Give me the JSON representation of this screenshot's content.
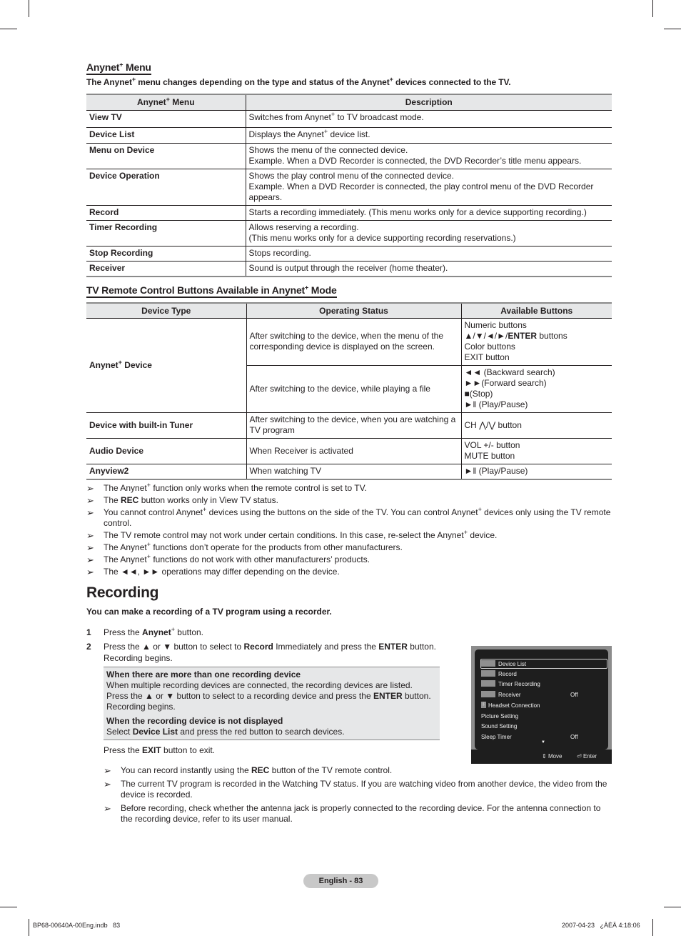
{
  "anynet_menu": {
    "heading": "Anynet",
    "heading_suffix": "Menu",
    "subheading_part1": "The Anynet",
    "subheading_part2": "menu changes depending on the type and status of the Anynet",
    "subheading_part3": "devices connected to the TV.",
    "table": {
      "headers": {
        "menu_part1": "Anynet",
        "menu_part2": "Menu",
        "description": "Description"
      },
      "rows": [
        {
          "menu": "View TV",
          "desc_lines": [
            "Switches from Anynet",
            "to TV broadcast mode."
          ]
        },
        {
          "menu": "Device List",
          "desc_lines": [
            "Displays the Anynet",
            "device list."
          ]
        },
        {
          "menu": "Menu on Device",
          "desc_lines": [
            "Shows the menu of the connected device.",
            "Example. When a DVD Recorder is connected, the DVD Recorder’s title menu appears."
          ]
        },
        {
          "menu": "Device Operation",
          "desc_lines": [
            "Shows the play control menu of the connected device.",
            "Example. When a DVD Recorder is connected, the play control menu of the DVD Recorder appears."
          ]
        },
        {
          "menu": "Record",
          "desc_lines": [
            "Starts a recording immediately. (This menu works only for a device supporting recording.)"
          ]
        },
        {
          "menu": "Timer Recording",
          "desc_lines": [
            "Allows reserving a recording.",
            "(This menu works only for a device supporting recording reservations.)"
          ]
        },
        {
          "menu": "Stop Recording",
          "desc_lines": [
            "Stops recording."
          ]
        },
        {
          "menu": "Receiver",
          "desc_lines": [
            "Sound is output through the receiver (home theater)."
          ]
        }
      ]
    }
  },
  "remote_buttons": {
    "heading_part1": "TV Remote Control Buttons Available in Anynet",
    "heading_part2": "Mode",
    "table": {
      "headers": [
        "Device Type",
        "Operating Status",
        "Available Buttons"
      ],
      "anynet_device": {
        "type_part1": "Anynet",
        "type_part2": "Device",
        "row1": {
          "status": "After switching to the device, when the menu of the corresponding device is displayed on the screen.",
          "buttons": [
            "Numeric buttons",
            "▲/▼/◄/►/",
            "ENTER",
            "buttons",
            "Color buttons",
            "EXIT button"
          ]
        },
        "row2": {
          "status": "After switching to the device, while playing a file",
          "buttons": [
            "◄◄ (Backward search)",
            "►►(Forward search)",
            "■(Stop)",
            "►ǁ (Play/Pause)"
          ]
        }
      },
      "rows": [
        {
          "type": "Device with built-in Tuner",
          "status": "After switching to the device, when you are watching a TV program",
          "buttons": [
            "CH ⋀/⋁ button"
          ]
        },
        {
          "type": "Audio Device",
          "status": "When Receiver is activated",
          "buttons": [
            "VOL +/- button",
            "MUTE button"
          ]
        },
        {
          "type": "Anyview2",
          "status": "When watching TV",
          "buttons": [
            "►ǁ (Play/Pause)"
          ]
        }
      ]
    },
    "notes": [
      {
        "parts": [
          "The Anynet",
          "function only works when the remote control is set to TV."
        ]
      },
      {
        "pre": "The ",
        "bold": "REC",
        "post": " button works only in View TV status."
      },
      {
        "parts": [
          "You cannot control Anynet",
          "devices using the buttons on the side of the TV. You can control Anynet",
          "devices only using the TV remote control."
        ]
      },
      {
        "parts": [
          "The TV remote control may not work under certain conditions. In this case, re-select the Anynet",
          "device."
        ]
      },
      {
        "parts": [
          "The Anynet",
          "functions don’t operate for the products from other manufacturers."
        ]
      },
      {
        "parts": [
          "The Anynet",
          "functions do not work with other manufacturers’ products."
        ]
      },
      {
        "text": "The ◄◄, ►► operations may differ depending on the device."
      }
    ]
  },
  "recording": {
    "title": "Recording",
    "lead": "You can make a recording of a TV program using a recorder.",
    "steps": [
      {
        "num": "1",
        "pre": "Press the ",
        "bold": "Anynet",
        "post": " button."
      },
      {
        "num": "2",
        "pre": "Press the ▲ or ▼ button to select to ",
        "bold": "Record",
        "mid": " Immediately and press the ",
        "bold2": "ENTER",
        "post": " button. Recording begins."
      }
    ],
    "infobox": {
      "title1": "When there are more than one recording device",
      "line1": "When multiple recording devices are connected, the recording devices are listed.",
      "line2_pre": "Press the ▲ or ▼ button to select to a recording device and press the ",
      "line2_bold": "ENTER",
      "line2_post": " button. Recording begins.",
      "title2": "When the recording device is not displayed",
      "line3_pre": "Select ",
      "line3_bold": "Device List",
      "line3_post": " and press the red button to search devices."
    },
    "exit_pre": "Press the ",
    "exit_bold": "EXIT",
    "exit_post": " button to exit.",
    "notes": [
      {
        "pre": "You can record instantly using the ",
        "bold": "REC",
        "post": " button of the TV remote control."
      },
      {
        "text": "The current TV program is recorded in the Watching TV status. If you are watching video from another device, the video from the device is recorded."
      },
      {
        "text": "Before recording, check whether the antenna jack is properly connected to the recording device. For the antenna connection to the recording device, refer to its user manual."
      }
    ],
    "osd": {
      "items": [
        {
          "label": "Device List",
          "icon": "anynet-logo",
          "value": "",
          "selected": true
        },
        {
          "label": "Record",
          "icon": "anynet-logo",
          "value": ""
        },
        {
          "label": "Timer Recording",
          "icon": "anynet-logo",
          "value": ""
        },
        {
          "label": "Receiver",
          "icon": "anynet-logo",
          "value": "Off"
        },
        {
          "label": "Headset Connection",
          "icon": "bluetooth-icon",
          "value": ""
        },
        {
          "label": "Picture Setting",
          "icon": "",
          "value": ""
        },
        {
          "label": "Sound Setting",
          "icon": "",
          "value": ""
        },
        {
          "label": "Sleep Timer",
          "icon": "",
          "value": "Off"
        }
      ],
      "more_indicator": "▼",
      "footer_move": "Move",
      "footer_enter": "Enter"
    }
  },
  "footer": {
    "page_label": "English - 83",
    "slug_left": "BP68-00640A-00Eng.indb   83",
    "slug_right": "2007-04-23   ¿ÀÈÄ 4:18:06"
  }
}
